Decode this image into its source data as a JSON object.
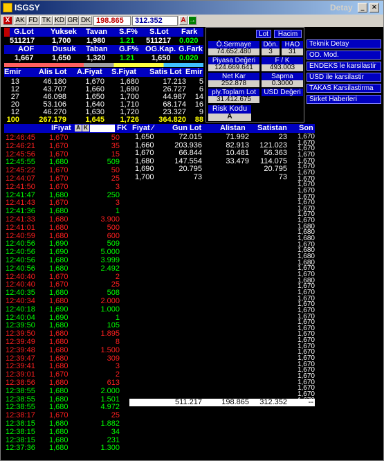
{
  "window": {
    "title": "ISGSY",
    "right_label": "Detay",
    "btn_minimize": "_",
    "btn_maximize": "□",
    "btn_close": "×"
  },
  "toolbar": {
    "close_label": "X",
    "btns": [
      "AK",
      "FD",
      "TK",
      "KD",
      "GR",
      "DK"
    ],
    "field_lot": "198.865",
    "field_price": "312.352",
    "a_label": "A",
    "arrow_label": "→"
  },
  "summary": {
    "headers1": [
      "G.Lot",
      "Yuksek",
      "Tavan",
      "S.F%",
      "S.Lot",
      "Fark"
    ],
    "values1": [
      "511217",
      "1,700",
      "1,980",
      "1.21",
      "511217",
      "0.020"
    ],
    "headers2": [
      "AOF",
      "Dusuk",
      "Taban",
      "G.F%",
      "OG.Kap.",
      "G.Fark"
    ],
    "values2": [
      "1,667",
      "1,650",
      "1,320",
      "1.21",
      "1,650",
      "0.020"
    ]
  },
  "stats": {
    "lot_btn": "Lot",
    "hacim_btn": "Hacim",
    "o_sermaye_label": "Ö.Sermaye",
    "o_sermaye_value": "74.652.480",
    "don_label": "Dön.",
    "don_value": "3",
    "hao_label": "HAO",
    "hao_value": "31",
    "piyasa_label": "Piyasa Değeri",
    "piyasa_value": "124.669.641",
    "fk_label": "F / K",
    "fk_value": "493.003",
    "netkar_label": "Net Kar",
    "netkar_value": "252.878",
    "sapma_label": "Sapma",
    "sapma_value": "0.3000",
    "toplam_label": "ply.Toplam Lot",
    "toplam_value": "31.412.675",
    "usd_label": "USD Değeri",
    "risk_label": "Risk Kodu",
    "risk_value": "A"
  },
  "side_menu": [
    "Teknik Detay",
    "OD. Mod.",
    "ENDEKS le karsilastir",
    "USD ile karsilastir",
    "TAKAS Karsilastirma",
    "Sirket Haberleri"
  ],
  "orderbook": {
    "headers": [
      "Emir",
      "Alis Lot",
      "A.Fiyat",
      "S.Fiyat",
      "Satis Lot",
      "Emir"
    ],
    "rows": [
      [
        "13",
        "46.180",
        "1,670",
        "1,680",
        "17.213",
        "5"
      ],
      [
        "12",
        "43.707",
        "1,660",
        "1,690",
        "26.727",
        "6"
      ],
      [
        "27",
        "46.098",
        "1,650",
        "1,700",
        "44.987",
        "14"
      ],
      [
        "20",
        "53.106",
        "1,640",
        "1,710",
        "68.174",
        "16"
      ],
      [
        "12",
        "46.270",
        "1,630",
        "1,720",
        "23.327",
        "9"
      ]
    ],
    "total": [
      "100",
      "267.179",
      "1,645",
      "1,726",
      "364.820",
      "88"
    ]
  },
  "trades": {
    "headers": [
      "",
      "IFiyat",
      "",
      "FK"
    ],
    "mini_a": "A",
    "mini_k": "K",
    "rows": [
      {
        "time": "12:46:45",
        "price": "1,670",
        "lot": "50",
        "c": "red"
      },
      {
        "time": "12:46:21",
        "price": "1,670",
        "lot": "35",
        "c": "red"
      },
      {
        "time": "12:45:56",
        "price": "1,670",
        "lot": "15",
        "c": "red"
      },
      {
        "time": "12:45:55",
        "price": "1,680",
        "lot": "509",
        "c": "green"
      },
      {
        "time": "12:45:22",
        "price": "1,670",
        "lot": "50",
        "c": "red"
      },
      {
        "time": "12:44:07",
        "price": "1,670",
        "lot": "25",
        "c": "red"
      },
      {
        "time": "12:41:50",
        "price": "1,670",
        "lot": "3",
        "c": "red"
      },
      {
        "time": "12:41:47",
        "price": "1,680",
        "lot": "250",
        "c": "green"
      },
      {
        "time": "12:41:43",
        "price": "1,670",
        "lot": "3",
        "c": "red"
      },
      {
        "time": "12:41:36",
        "price": "1,680",
        "lot": "1",
        "c": "green"
      },
      {
        "time": "12:41:33",
        "price": "1,680",
        "lot": "3.900",
        "c": "red"
      },
      {
        "time": "12:41:01",
        "price": "1,680",
        "lot": "500",
        "c": "red"
      },
      {
        "time": "12:40:59",
        "price": "1,680",
        "lot": "600",
        "c": "red"
      },
      {
        "time": "12:40:56",
        "price": "1,690",
        "lot": "509",
        "c": "green"
      },
      {
        "time": "12:40:56",
        "price": "1,690",
        "lot": "5.000",
        "c": "green"
      },
      {
        "time": "12:40:56",
        "price": "1,680",
        "lot": "3.999",
        "c": "green"
      },
      {
        "time": "12:40:56",
        "price": "1,680",
        "lot": "2.492",
        "c": "green"
      },
      {
        "time": "12:40:40",
        "price": "1,670",
        "lot": "2",
        "c": "red"
      },
      {
        "time": "12:40:40",
        "price": "1,670",
        "lot": "25",
        "c": "red"
      },
      {
        "time": "12:40:35",
        "price": "1,680",
        "lot": "508",
        "c": "green"
      },
      {
        "time": "12:40:34",
        "price": "1,680",
        "lot": "2.000",
        "c": "red"
      },
      {
        "time": "12:40:18",
        "price": "1,690",
        "lot": "1.000",
        "c": "green"
      },
      {
        "time": "12:40:04",
        "price": "1,690",
        "lot": "1",
        "c": "green"
      },
      {
        "time": "12:39:50",
        "price": "1,680",
        "lot": "105",
        "c": "green"
      },
      {
        "time": "12:39:50",
        "price": "1,680",
        "lot": "1.895",
        "c": "red"
      },
      {
        "time": "12:39:49",
        "price": "1,680",
        "lot": "8",
        "c": "red"
      },
      {
        "time": "12:39:48",
        "price": "1,680",
        "lot": "1.500",
        "c": "red"
      },
      {
        "time": "12:39:47",
        "price": "1,680",
        "lot": "309",
        "c": "red"
      },
      {
        "time": "12:39:41",
        "price": "1,680",
        "lot": "3",
        "c": "red"
      },
      {
        "time": "12:39:01",
        "price": "1,670",
        "lot": "2",
        "c": "red"
      },
      {
        "time": "12:38:56",
        "price": "1,680",
        "lot": "613",
        "c": "red"
      },
      {
        "time": "12:38:55",
        "price": "1,680",
        "lot": "2.000",
        "c": "green"
      },
      {
        "time": "12:38:55",
        "price": "1,680",
        "lot": "1.501",
        "c": "green"
      },
      {
        "time": "12:38:55",
        "price": "1,680",
        "lot": "4.972",
        "c": "green"
      },
      {
        "time": "12:38:17",
        "price": "1,670",
        "lot": "25",
        "c": "red"
      },
      {
        "time": "12:38:15",
        "price": "1,680",
        "lot": "1.882",
        "c": "green"
      },
      {
        "time": "12:38:15",
        "price": "1,680",
        "lot": "34",
        "c": "green"
      },
      {
        "time": "12:38:15",
        "price": "1,680",
        "lot": "231",
        "c": "green"
      },
      {
        "time": "12:37:36",
        "price": "1,680",
        "lot": "1.300",
        "c": "green"
      }
    ]
  },
  "depth": {
    "headers": [
      "Fiyat ⁄",
      "Gun Lot",
      "Alistan",
      "Satistan",
      "Son"
    ],
    "rows": [
      [
        "1,650",
        "72.015",
        "71.992",
        "23"
      ],
      [
        "1,660",
        "203.936",
        "82.913",
        "121.023"
      ],
      [
        "1,670",
        "66.844",
        "10.481",
        "56.363"
      ],
      [
        "1,680",
        "147.554",
        "33.479",
        "114.075"
      ],
      [
        "1,690",
        "20.795",
        "",
        "20.795"
      ],
      [
        "1,700",
        "73",
        "",
        "73"
      ]
    ],
    "son": [
      "1,670",
      "1,670",
      "1,670",
      "1,670",
      "1,670",
      "1,670",
      "1,670",
      "1,670",
      "1,670",
      "1,670",
      "1,670",
      "1,670",
      "1,670",
      "1,670",
      "1,670",
      "1,680",
      "1,680",
      "1,680",
      "1,670",
      "1,680",
      "1,680",
      "1,680",
      "1,670",
      "1,670",
      "1,680",
      "1,670",
      "1,670",
      "1,670",
      "1,670",
      "1,670",
      "1,670",
      "1,670",
      "1,670",
      "1,670",
      "1,670",
      "1,670",
      "1,670",
      "1,670",
      "1,670",
      "1,670",
      "1,670",
      "1,670",
      "1,670",
      "1,670",
      "1,670"
    ],
    "totals": [
      "511.217",
      "198.865",
      "312.352",
      "--"
    ]
  }
}
